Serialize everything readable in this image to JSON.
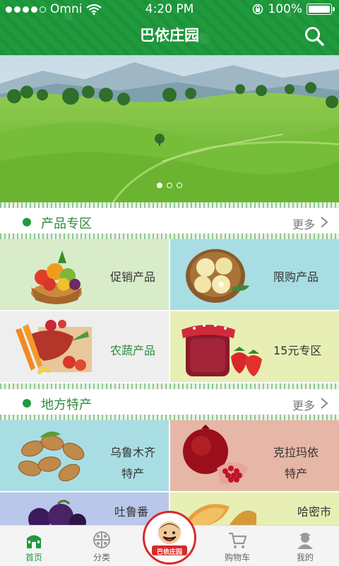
{
  "status_bar": {
    "carrier": "Omni",
    "time": "4:20 PM",
    "battery": "100%"
  },
  "nav": {
    "title": "巴依庄园"
  },
  "banner": {
    "page_count": 3,
    "active_page": 1
  },
  "sections": [
    {
      "title": "产品专区",
      "more": "更多",
      "tiles": [
        {
          "label": "促销产品",
          "bg": "#d9ecc9"
        },
        {
          "label": "限购产品",
          "bg": "#a9dde4"
        },
        {
          "label": "农蔬产品",
          "bg": "#eeeeee"
        },
        {
          "label": "15元专区",
          "bg": "#e7efb4"
        }
      ]
    },
    {
      "title": "地方特产",
      "more": "更多",
      "tiles": [
        {
          "label_line1": "乌鲁木齐",
          "label_line2": "特产",
          "bg": "#a9dde4"
        },
        {
          "label_line1": "克拉玛依",
          "label_line2": "特产",
          "bg": "#e6b6a6"
        },
        {
          "label_line1": "吐鲁番",
          "bg": "#b9c7ea"
        },
        {
          "label_line1": "哈密市",
          "bg": "#e7efb4"
        }
      ]
    }
  ],
  "tabbar": {
    "items": [
      {
        "label": "首页",
        "active": true
      },
      {
        "label": "分类",
        "active": false
      },
      {
        "label": "购物车",
        "active": false
      },
      {
        "label": "我的",
        "active": false
      }
    ],
    "logo_text": "巴依庄园"
  },
  "colors": {
    "brand_green": "#1f9a3d"
  }
}
